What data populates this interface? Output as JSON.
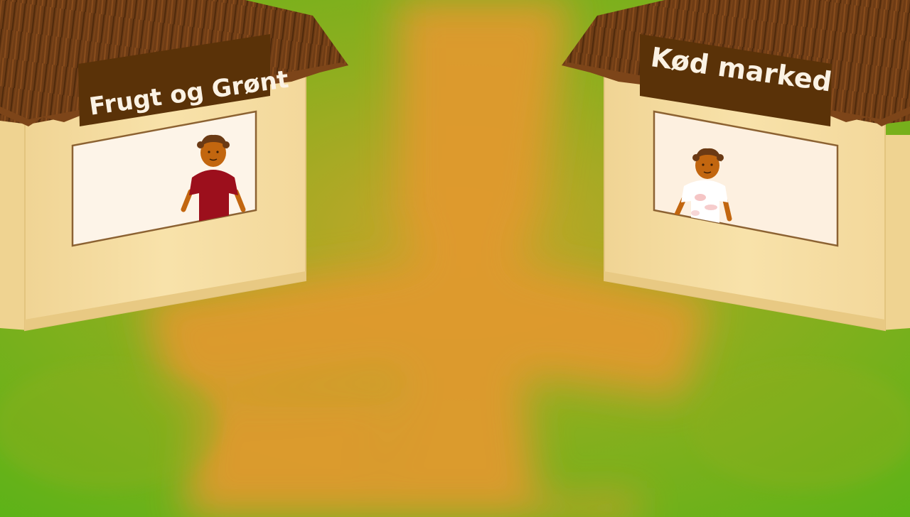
{
  "scene": {
    "name": "market-street",
    "colors": {
      "grass": "#5cb318",
      "path": "#e09a2e",
      "stall_wall": "#f7dfa6",
      "stall_window": "#fdf4e8",
      "roof": "#6b3a14",
      "sign": "#5a3208",
      "sign_text": "#fbf2e4"
    }
  },
  "stalls": [
    {
      "sign_label": "Frugt og Grønt",
      "vendor_shirt_color": "#9c0f1c",
      "vendor_skin_color": "#c2660f"
    },
    {
      "sign_label": "Kød marked",
      "vendor_shirt_color": "#ffffff",
      "vendor_skin_color": "#c2660f"
    }
  ]
}
